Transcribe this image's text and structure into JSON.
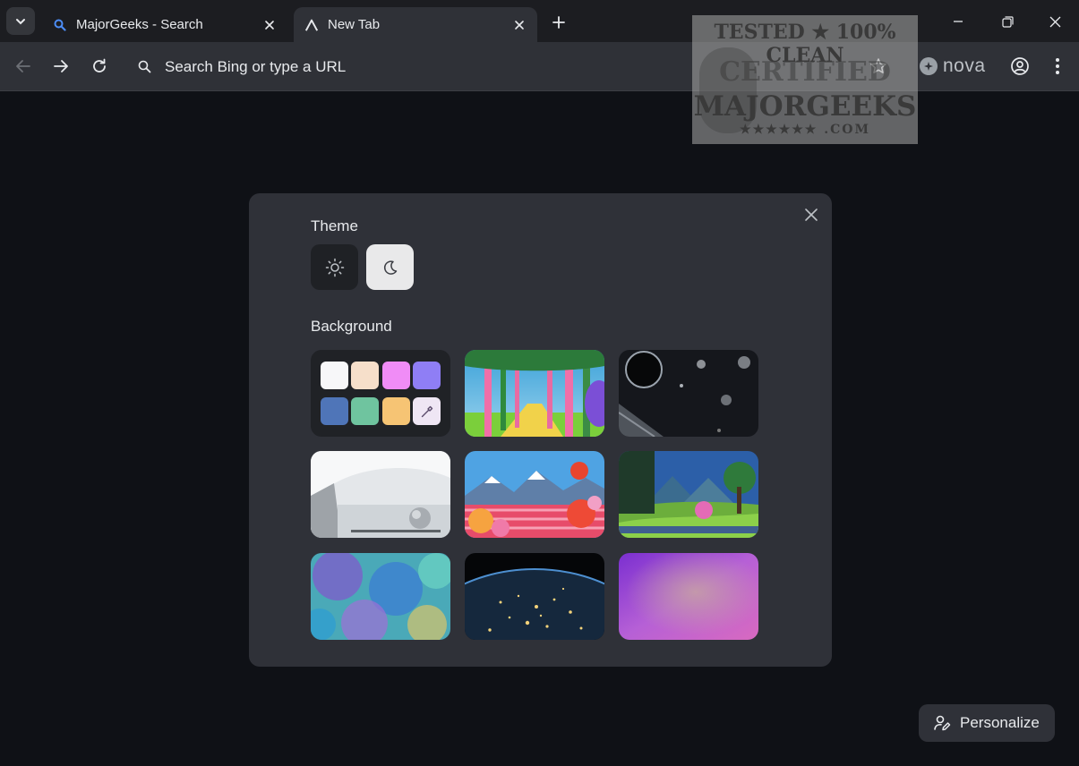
{
  "tabs": [
    {
      "title": "MajorGeeks - Search",
      "favicon": "search-icon"
    },
    {
      "title": "New Tab",
      "favicon": "browser-logo-icon"
    }
  ],
  "toolbar": {
    "omnibox_text": "Search Bing or type a URL",
    "profile_label": "nova"
  },
  "watermark": {
    "line1": "TESTED ★ 100% CLEAN",
    "line2": "CERTIFIED",
    "line3": "MAJORGEEKS",
    "line4": "★★★★★★ .COM"
  },
  "dialog": {
    "theme_title": "Theme",
    "background_title": "Background",
    "theme_options": [
      "sun-icon",
      "moon-icon"
    ],
    "selected_theme": "dark",
    "swatch_colors": [
      "#f7f7f9",
      "#f6dfca",
      "#f08cf6",
      "#8f7ef5",
      "#4f75b8",
      "#6fc49f",
      "#f6c474",
      "#efe6f4"
    ],
    "backgrounds": [
      "pink-forest",
      "space-planet",
      "white-room-sphere",
      "flowers-mountains",
      "green-valley",
      "watercolor-nebula",
      "earth-night-lights",
      "purple-gradient"
    ]
  },
  "personalize": {
    "label": "Personalize"
  }
}
